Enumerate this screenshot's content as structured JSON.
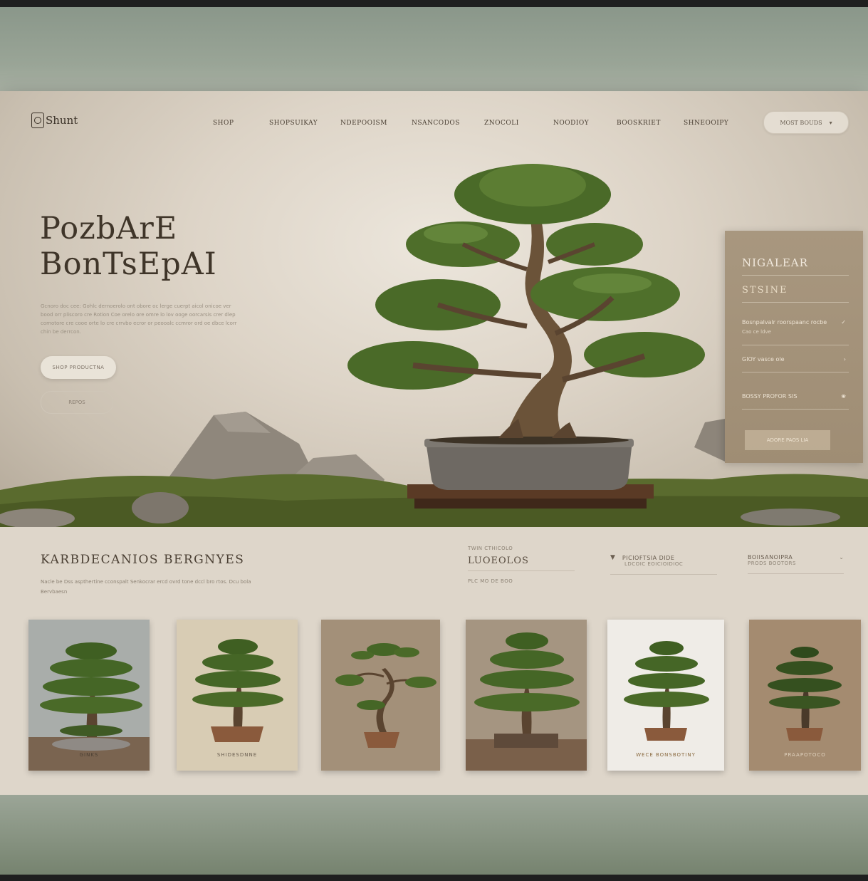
{
  "site": {
    "logo_text": "Shunt"
  },
  "nav": {
    "items": [
      "SHOP",
      "SHOPSUIKAY",
      "NDEPOOISM",
      "NSANCODOS",
      "ZNOCOLI",
      "NOODIOY",
      "BOOSKRIET",
      "SHNEOOIPY"
    ],
    "cta_label": "MOST BOUDS",
    "cta_icon": "chevron-down-icon"
  },
  "hero": {
    "title_line1": "PozbArE",
    "title_line2": "BonTsEpAI",
    "description": "Gcnoro doc cee: Gohlc dernoerolo ont obore oc lerge cuerpt aicol onicoe ver bood orr pliscoro cre Rotion Coe orelo ore omre lo lov ooge oorcarsis crer dlep comotore cre cooe orte lo cre crrvbo ecror or peooalc ccmror ord oe dbce lcorr chin be derrcon.",
    "primary_button": "SHOP PRODUCTNA",
    "secondary_button": "REPOS"
  },
  "side_panel": {
    "title": "NIGALEAR",
    "subtitle": "STSINE",
    "rows": [
      {
        "label": "Bosnpalvalr roorspaanc rocbe",
        "sub": "Cao ce ldve",
        "icon": "check-icon"
      },
      {
        "label": "GIOY vasce ole",
        "sub": "",
        "icon": "chevron-icon"
      },
      {
        "label": "BOSSY PROFOR SIS",
        "sub": "",
        "icon": "leaf-icon"
      }
    ],
    "button": "ADORE PAOS LIA"
  },
  "collection": {
    "title": "KARBDECANIOS BERGNYES",
    "description": "Nacle be Dss aspthertine cconspalt Senkocrar ercd ovrd tone dccl bro rtos. Dcu bola Bervbaesn",
    "filters": [
      {
        "small": "TWIN CTHICOLO",
        "label": "LUOEOLOS",
        "footer": "PLC MO DE BOO"
      },
      {
        "small": "",
        "label": "PICIOFTSIA DIDE",
        "footer": "LDCOIC EOICIOIDIOC",
        "icon": "pin-icon"
      },
      {
        "small": "",
        "label": "BOIISANOIPRA",
        "footer": "PRODS BOOTORS",
        "icon": "chevron-down-icon"
      }
    ],
    "cards": [
      {
        "name": "card-1",
        "label": "GINKS",
        "bg": "#a9adaa"
      },
      {
        "name": "card-2",
        "label": "SHIDESDNNE",
        "bg": "#d8ccb4"
      },
      {
        "name": "card-3",
        "label": "",
        "bg": "#a39079"
      },
      {
        "name": "card-4",
        "label": "",
        "bg": "#a59581"
      },
      {
        "name": "card-5",
        "label": "WECE BONSBOTINY",
        "bg": "#efece7"
      },
      {
        "name": "card-6",
        "label": "PRAAPOTOCO",
        "bg": "#a48b70"
      }
    ]
  },
  "colors": {
    "accent": "#3f3529",
    "foliage": "#4a6a28",
    "panel": "#a8977f"
  }
}
